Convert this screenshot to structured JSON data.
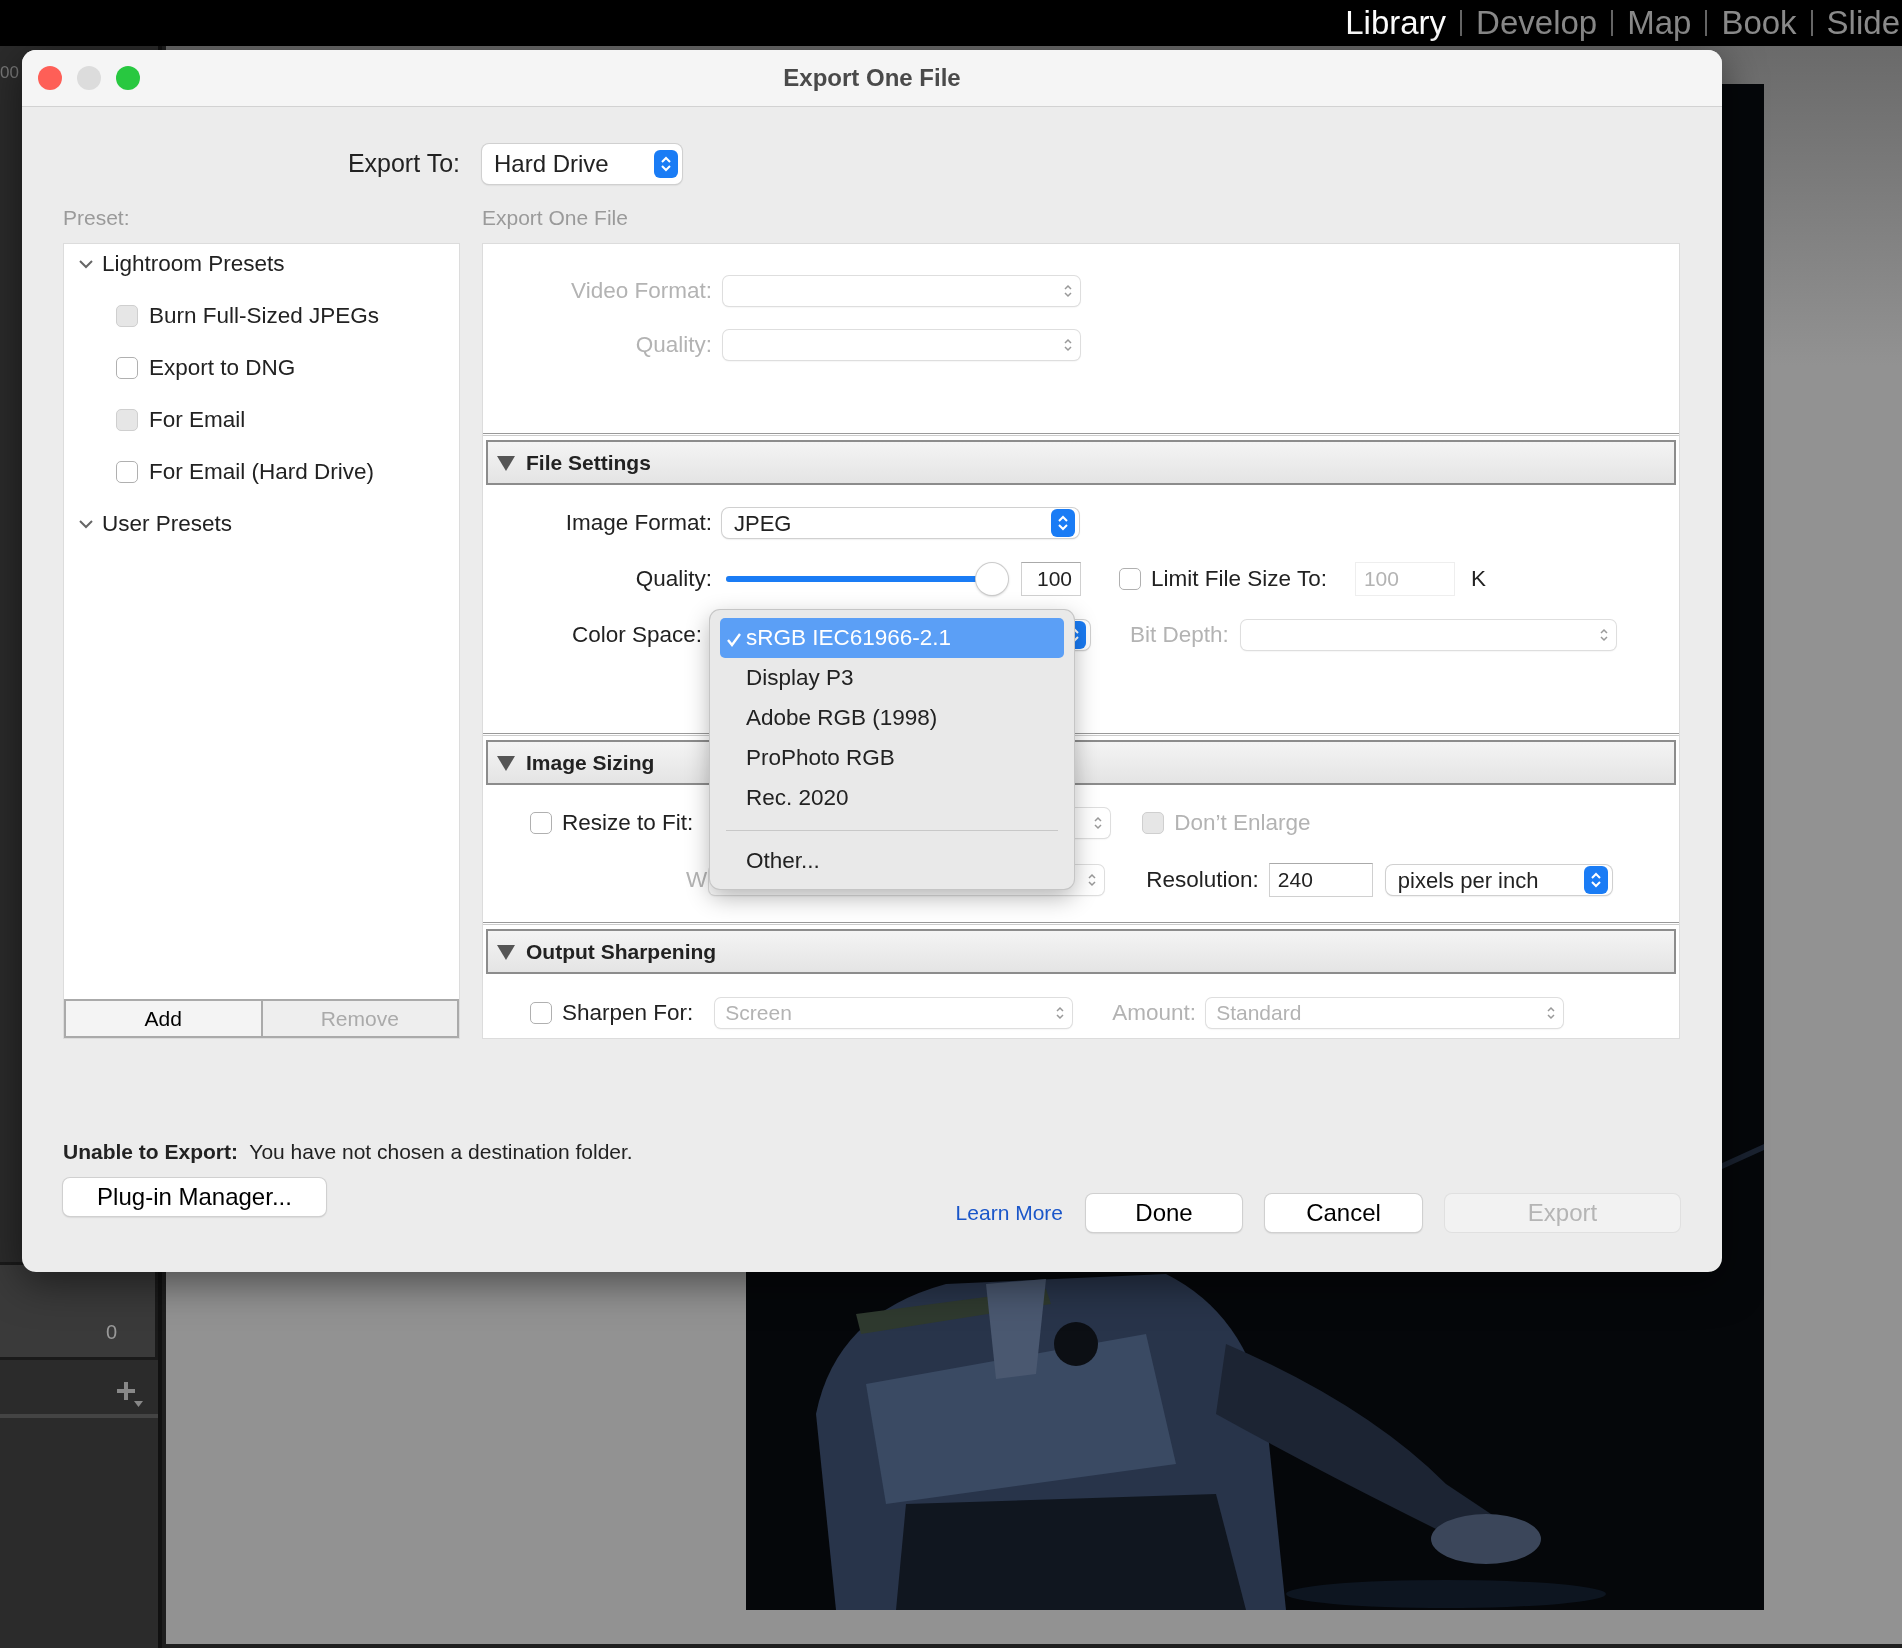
{
  "app_bar": {
    "modules": [
      {
        "label": "Library",
        "selected": true
      },
      {
        "label": "Develop",
        "selected": false
      },
      {
        "label": "Map",
        "selected": false
      },
      {
        "label": "Book",
        "selected": false
      },
      {
        "label": "Slide",
        "selected": false
      }
    ]
  },
  "left_panel": {
    "zoom_text": "00",
    "count": "0"
  },
  "dialog": {
    "title": "Export One File",
    "export_to": {
      "label": "Export To:",
      "value": "Hard Drive"
    },
    "preset_label": "Preset:",
    "preset_tree": [
      {
        "label": "Lightroom Presets",
        "expanded": true,
        "children": [
          {
            "label": "Burn Full-Sized JPEGs",
            "checked": false,
            "dimmed": true
          },
          {
            "label": "Export to DNG",
            "checked": false,
            "dimmed": false
          },
          {
            "label": "For Email",
            "checked": false,
            "dimmed": true
          },
          {
            "label": "For Email (Hard Drive)",
            "checked": false,
            "dimmed": false
          }
        ]
      },
      {
        "label": "User Presets",
        "expanded": true
      }
    ],
    "preset_buttons": [
      {
        "label": "Add",
        "disabled": false
      },
      {
        "label": "Remove",
        "disabled": true
      }
    ],
    "settings_label": "Export One File",
    "video": {
      "disabled": true,
      "rows": [
        {
          "label": "Video Format:"
        },
        {
          "label": "Quality:"
        }
      ]
    },
    "file_settings": {
      "title": "File Settings",
      "expanded": true,
      "image_format": {
        "label": "Image Format:",
        "value": "JPEG"
      },
      "quality": {
        "label": "Quality:",
        "level": 1,
        "value": "100"
      },
      "limit_size": {
        "label": "Limit File Size To:",
        "checked": false,
        "value": "100",
        "unit": "K"
      },
      "color_space": {
        "label": "Color Space:"
      },
      "bit_depth": {
        "label": "Bit Depth:",
        "disabled": true
      }
    },
    "color_space_menu": {
      "items": [
        {
          "kind": "option",
          "label": "sRGB IEC61966-2.1",
          "selected": true
        },
        {
          "kind": "option",
          "label": "Display P3",
          "selected": false
        },
        {
          "kind": "option",
          "label": "Adobe RGB (1998)",
          "selected": false
        },
        {
          "kind": "option",
          "label": "ProPhoto RGB",
          "selected": false
        },
        {
          "kind": "option",
          "label": "Rec. 2020",
          "selected": false
        },
        {
          "kind": "separator"
        },
        {
          "kind": "option",
          "label": "Other...",
          "selected": false
        }
      ]
    },
    "image_sizing": {
      "title": "Image Sizing",
      "expanded": true,
      "resize": {
        "label": "Resize to Fit:",
        "checked": false
      },
      "dont_enlarge": {
        "label": "Don’t Enlarge",
        "checked": false,
        "disabled": true
      },
      "width_label": "W",
      "resolution": {
        "label": "Resolution:",
        "value": "240",
        "unit": "pixels per inch"
      }
    },
    "output_sharpening": {
      "title": "Output Sharpening",
      "expanded": true,
      "sharpen": {
        "label": "Sharpen For:",
        "checked": false,
        "value": "Screen"
      },
      "amount": {
        "label": "Amount:",
        "value": "Standard"
      }
    },
    "status": "**Unable to Export:**  You have not chosen a destination folder.",
    "plugin_button": "Plug-in Manager...",
    "learn_more": "Learn More",
    "buttons": [
      {
        "label": "Done",
        "disabled": false
      },
      {
        "label": "Cancel",
        "disabled": false
      },
      {
        "label": "Export",
        "disabled": true
      }
    ]
  }
}
